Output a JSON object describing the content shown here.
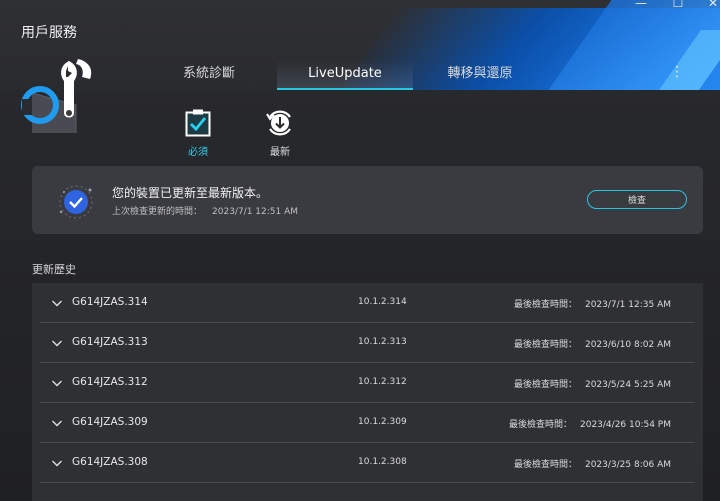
{
  "window": {
    "title": "用戶服務",
    "controls": {
      "minimize": "—",
      "maximize": "☐",
      "close": "✕"
    }
  },
  "tabs": [
    {
      "label": "系統診斷"
    },
    {
      "label": "LiveUpdate",
      "selected": true
    },
    {
      "label": "轉移與還原"
    }
  ],
  "more_menu": "⋮",
  "subtabs": [
    {
      "label": "必須",
      "selected": true
    },
    {
      "label": "最新"
    }
  ],
  "status": {
    "title": "您的裝置已更新至最新版本。",
    "last_check_label": "上次檢查更新的時間：",
    "last_check_time": "2023/7/1  12:51 AM",
    "check_button": "檢查"
  },
  "history": {
    "title": "更新歷史",
    "last_check_label": "最後檢查時間：",
    "rows": [
      {
        "name": "G614JZAS.314",
        "version": "10.1.2.314",
        "date": "2023/7/1  12:35 AM"
      },
      {
        "name": "G614JZAS.313",
        "version": "10.1.2.313",
        "date": "2023/6/10  8:02 AM"
      },
      {
        "name": "G614JZAS.312",
        "version": "10.1.2.312",
        "date": "2023/5/24  5:25 AM"
      },
      {
        "name": "G614JZAS.309",
        "version": "10.1.2.309",
        "date": "2023/4/26  10:54 PM"
      },
      {
        "name": "G614JZAS.308",
        "version": "10.1.2.308",
        "date": "2023/3/25  8:06 AM"
      }
    ]
  },
  "colors": {
    "accent": "#27c7e3",
    "card": "#3a3b40",
    "background": "#232428",
    "banner_blue": "#1a78e6"
  }
}
